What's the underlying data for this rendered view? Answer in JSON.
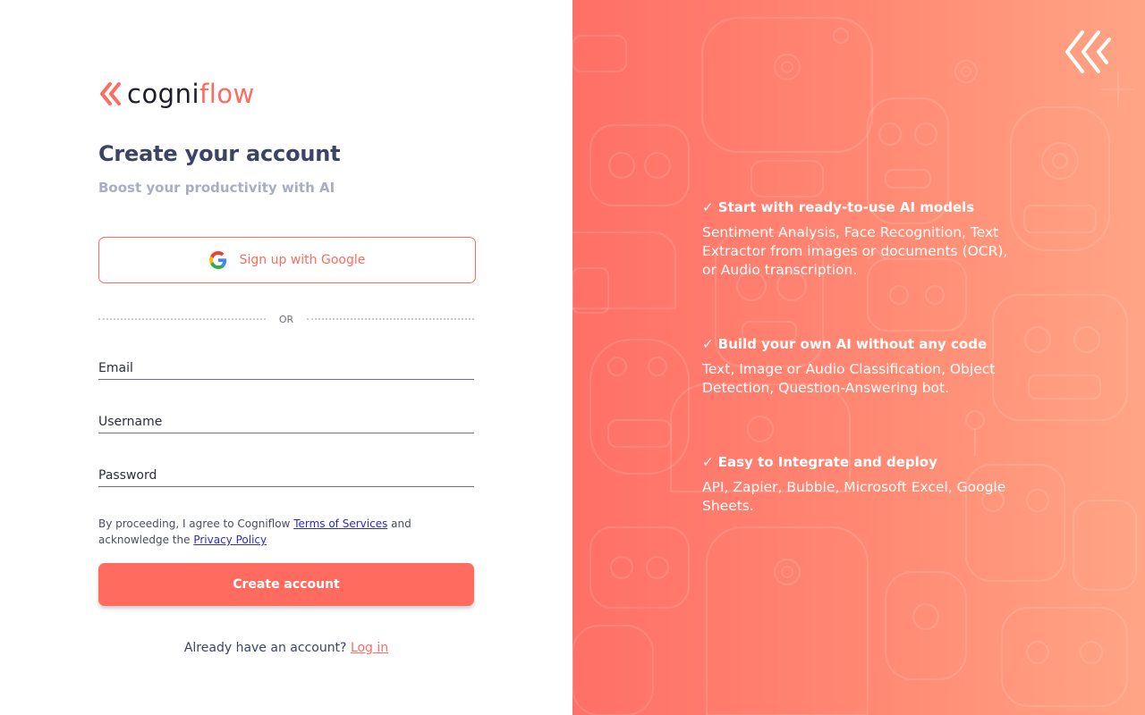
{
  "brand": {
    "name_part1": "cogni",
    "name_part2": "flow"
  },
  "form": {
    "title": "Create your account",
    "subtitle": "Boost your productivity with AI",
    "google_label": "Sign up with Google",
    "divider_text": "OR",
    "email_placeholder": "Email",
    "username_placeholder": "Username",
    "password_placeholder": "Password",
    "terms_prefix": "By proceeding, I agree to Cogniflow ",
    "terms_link": "Terms of Services",
    "terms_mid": " and acknowledge the ",
    "privacy_link": "Privacy Policy",
    "submit_label": "Create account",
    "login_prompt": "Already have an account? ",
    "login_link": "Log in"
  },
  "features": [
    {
      "title": "✓ Start with ready-to-use AI models",
      "text": "Sentiment Analysis, Face Recognition, Text Extractor from images or documents (OCR), or Audio transcription."
    },
    {
      "title": "✓ Build your own AI without any code",
      "text": "Text, Image or Audio Classification, Object Detection, Question-Answering bot."
    },
    {
      "title": "✓ Easy to Integrate and deploy",
      "text": "API, Zapier, Bubble, Microsoft Excel, Google Sheets."
    }
  ],
  "colors": {
    "accent": "#ff6b5e",
    "title": "#3b4465",
    "subtitle": "#a9aec3",
    "panel_start": "#ff6f66",
    "panel_end": "#ffa585"
  },
  "icons": {
    "brand": "cogniflow-chevron-logo",
    "google": "google-g-icon",
    "panel_logo": "cogniflow-chevron-logo-outline",
    "background": "robot-pattern"
  }
}
